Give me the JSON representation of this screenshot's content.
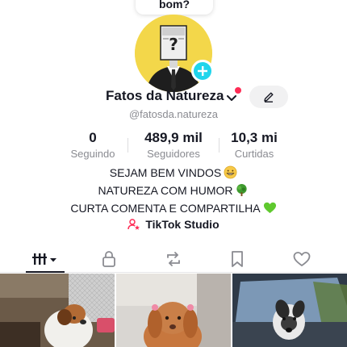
{
  "tooltip": {
    "text": "bom?"
  },
  "profile": {
    "display_name": "Fatos da Natureza",
    "handle": "@fatosda.natureza"
  },
  "stats": [
    {
      "value": "0",
      "label": "Seguindo"
    },
    {
      "value": "489,9 mil",
      "label": "Seguidores"
    },
    {
      "value": "10,3 mi",
      "label": "Curtidas"
    }
  ],
  "bio": {
    "line1": "SEJAM BEM VINDOS",
    "line2": "NATUREZA COM HUMOR",
    "line3": "CURTA COMENTA E COMPARTILHA"
  },
  "studio": {
    "label": "TikTok Studio"
  },
  "tabs": [
    {
      "icon": "videos-grid-icon"
    },
    {
      "icon": "lock-icon"
    },
    {
      "icon": "repost-icon"
    },
    {
      "icon": "bookmark-icon"
    },
    {
      "icon": "heart-icon"
    }
  ],
  "colors": {
    "accent": "#fe2c55",
    "add_badge": "#20d5ec",
    "avatar_bg": "#f3d74a"
  }
}
